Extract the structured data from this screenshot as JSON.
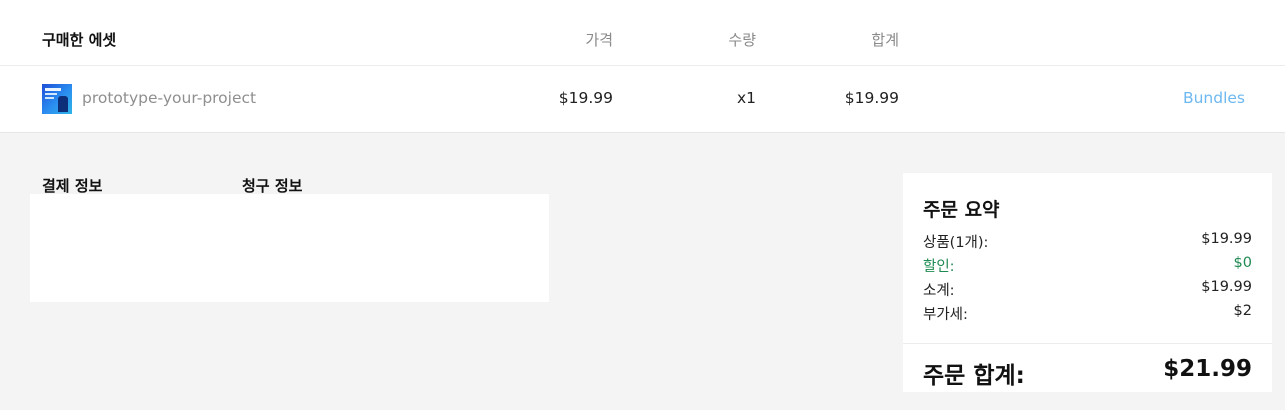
{
  "table": {
    "title": "구매한 에셋",
    "col_price": "가격",
    "col_qty": "수량",
    "col_total": "합계"
  },
  "item": {
    "name": "prototype-your-project",
    "price": "$19.99",
    "qty": "x1",
    "total": "$19.99",
    "link": "Bundles",
    "thumbnail_icon": "product-thumbnail"
  },
  "payment": {
    "payment_info_label": "결제 정보",
    "billing_info_label": "청구 정보"
  },
  "summary": {
    "title": "주문 요약",
    "lines": [
      {
        "label": "상품(1개):",
        "value": "$19.99"
      },
      {
        "label": "할인:",
        "value": "$0"
      },
      {
        "label": "소계:",
        "value": "$19.99"
      },
      {
        "label": "부가세:",
        "value": "$2"
      }
    ],
    "total_label": "주문 합계:",
    "total_value": "$21.99"
  },
  "colors": {
    "discount": "#1f8a52",
    "link": "#6db8f0",
    "background": "#f4f4f4"
  }
}
